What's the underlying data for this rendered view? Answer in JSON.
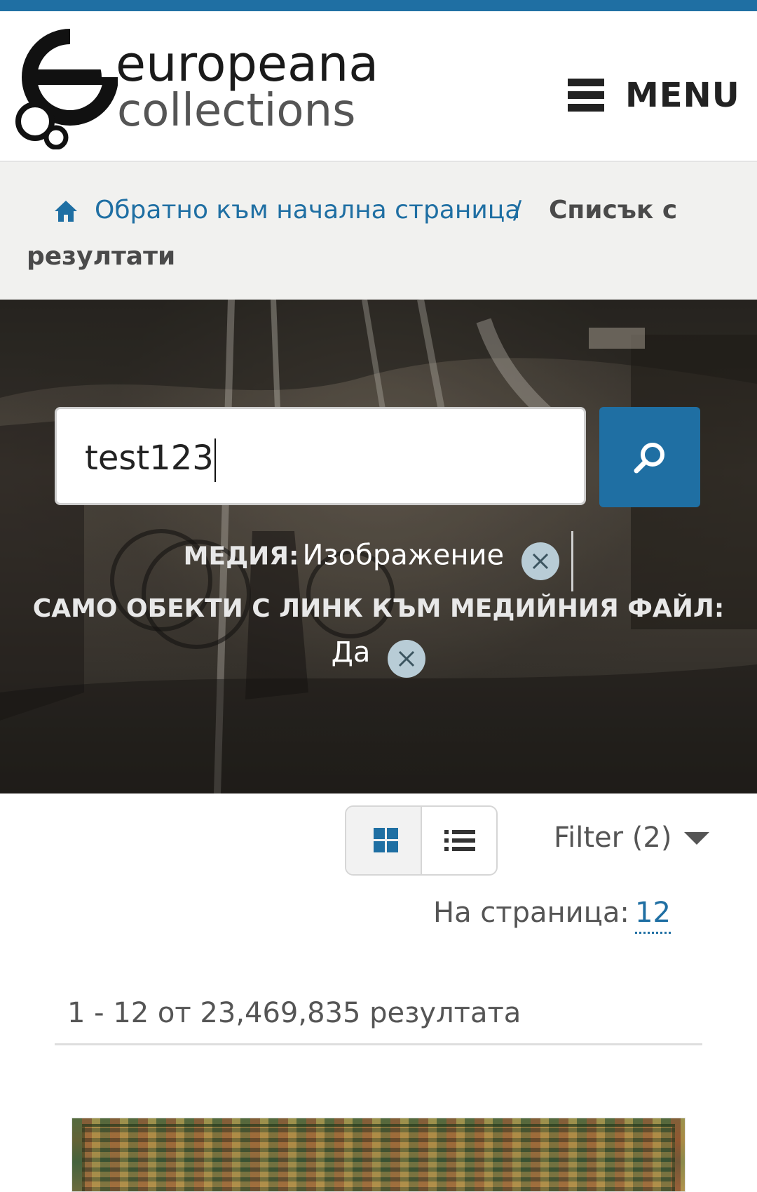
{
  "header": {
    "logo_line1": "europeana",
    "logo_line2": "collections",
    "menu_label": "MENU"
  },
  "breadcrumb": {
    "home_link": "Обратно към начална страница",
    "separator": "/",
    "current_line1": "Списък с",
    "current_line2": "резултати"
  },
  "search": {
    "value": "test123"
  },
  "facets": [
    {
      "key": "МЕДИЯ:",
      "value": "Изображение"
    },
    {
      "key": "САМО ОБЕКТИ С ЛИНК КЪМ МЕДИЙНИЯ ФАЙЛ:",
      "value": "Да"
    }
  ],
  "toolbar": {
    "filter_label": "Filter (2)",
    "per_page_label": "На страница:",
    "per_page_value": "12"
  },
  "results": {
    "count_text": "1 - 12 от 23,469,835 резултата"
  },
  "colors": {
    "accent": "#1f6fa3",
    "breadcrumb_bg": "#f1f1ef"
  },
  "icons": {
    "home": "home-icon",
    "search": "search-icon",
    "menu": "hamburger-icon",
    "remove": "close-icon",
    "grid": "grid-view-icon",
    "list": "list-view-icon",
    "dropdown": "caret-down-icon"
  }
}
